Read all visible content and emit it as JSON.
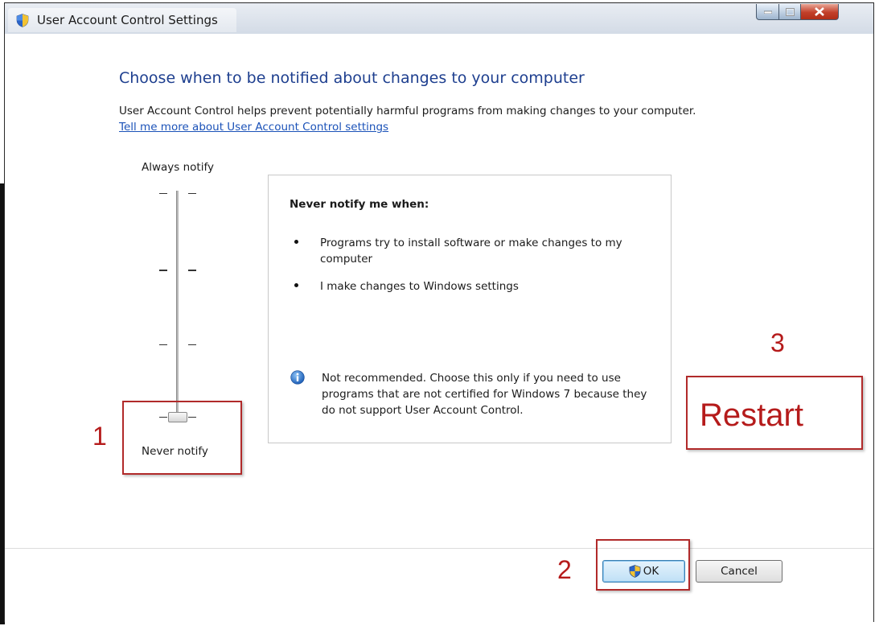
{
  "window": {
    "title": "User Account Control Settings"
  },
  "content": {
    "heading": "Choose when to be notified about changes to your computer",
    "description": "User Account Control helps prevent potentially harmful programs from making changes to your computer.",
    "link": "Tell me more about User Account Control settings"
  },
  "slider": {
    "top_label": "Always notify",
    "bottom_label": "Never notify",
    "level": 0,
    "levels": 4
  },
  "panel": {
    "title": "Never notify me when:",
    "bullets": [
      "Programs try to install software or make changes to my computer",
      "I make changes to Windows settings"
    ],
    "note": "Not recommended. Choose this only if you need to use programs that are not certified for Windows 7 because they do not support User Account Control."
  },
  "buttons": {
    "ok": "OK",
    "cancel": "Cancel"
  },
  "annotations": {
    "step1": "1",
    "step2": "2",
    "step3": "3",
    "restart": "Restart",
    "color": "#b51b1b"
  },
  "icons": {
    "title": "uac-shield-icon",
    "note": "info-icon",
    "ok": "uac-shield-icon"
  }
}
